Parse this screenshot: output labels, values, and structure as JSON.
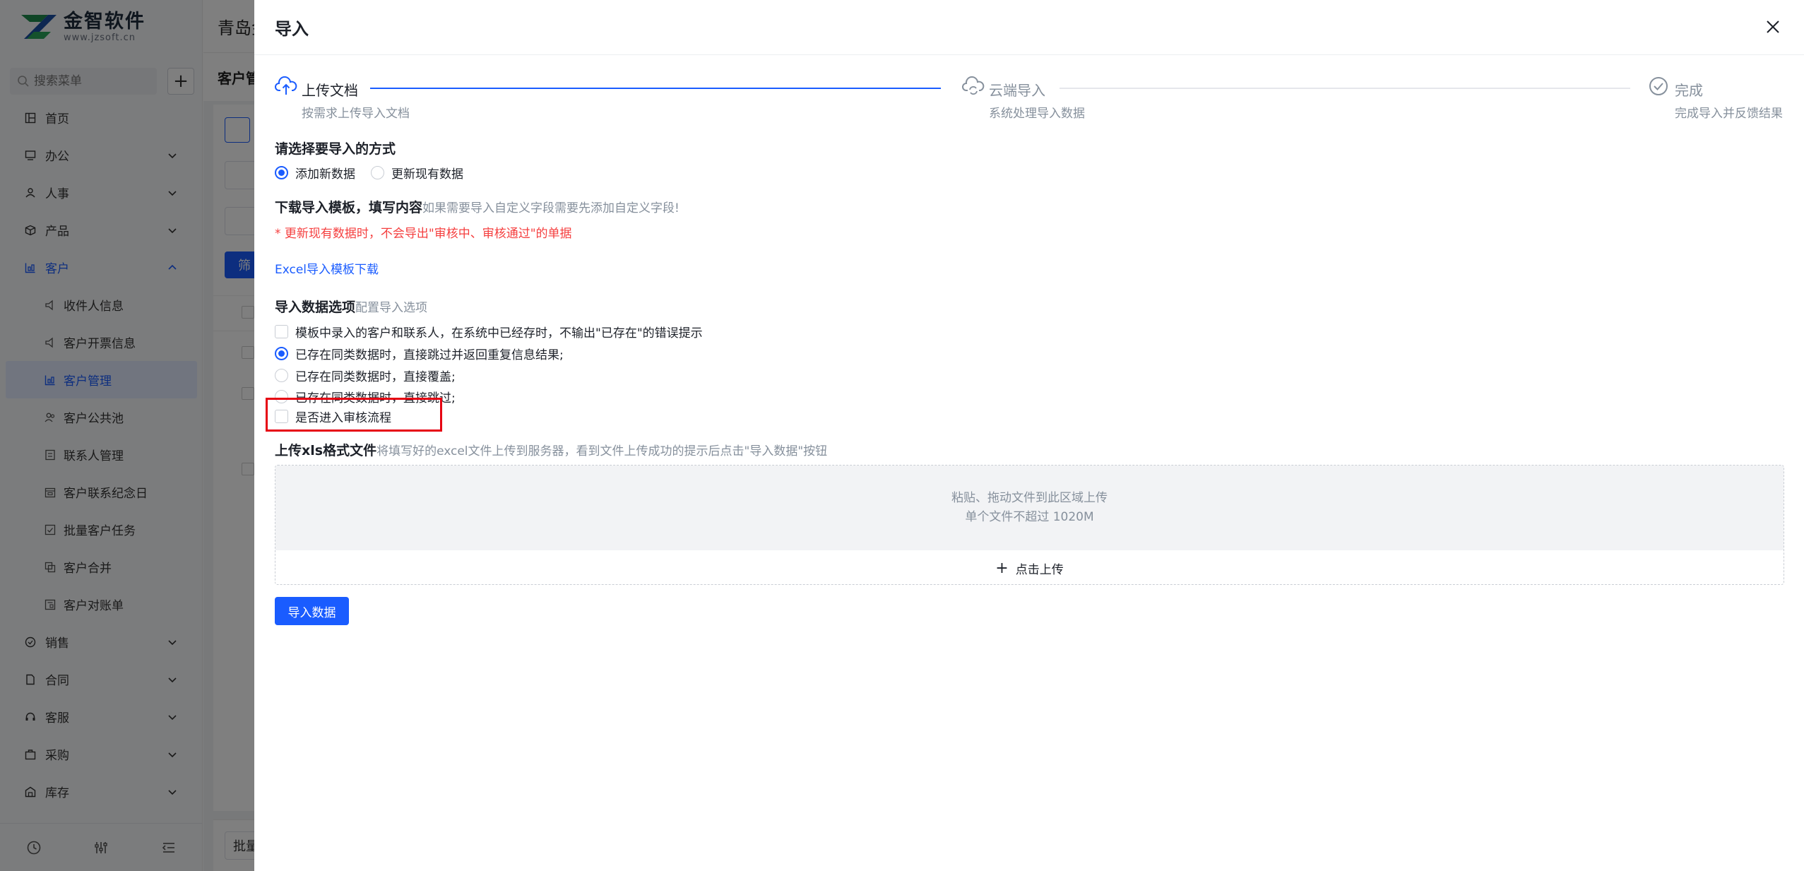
{
  "brand": {
    "name": "金智软件",
    "url": "www.jzsoft.cn"
  },
  "sidebar": {
    "search_placeholder": "搜索菜单",
    "add_label": "+",
    "items": [
      {
        "label": "首页"
      },
      {
        "label": "办公"
      },
      {
        "label": "人事"
      },
      {
        "label": "产品"
      },
      {
        "label": "客户"
      },
      {
        "label": "销售"
      },
      {
        "label": "合同"
      },
      {
        "label": "客服"
      },
      {
        "label": "采购"
      },
      {
        "label": "库存"
      }
    ],
    "sub_items": [
      {
        "label": "收件人信息"
      },
      {
        "label": "客户开票信息"
      },
      {
        "label": "客户管理"
      },
      {
        "label": "客户公共池"
      },
      {
        "label": "联系人管理"
      },
      {
        "label": "客户联系纪念日"
      },
      {
        "label": "批量客户任务"
      },
      {
        "label": "客户合并"
      },
      {
        "label": "客户对账单"
      }
    ]
  },
  "main": {
    "header_title": "青岛金",
    "tab_title": "客户管",
    "filter_label": "筛",
    "bottom_button": "批量"
  },
  "drawer": {
    "title": "导入",
    "steps": [
      {
        "title": "上传文档",
        "desc": "按需求上传导入文档"
      },
      {
        "title": "云端导入",
        "desc": "系统处理导入数据"
      },
      {
        "title": "完成",
        "desc": "完成导入并反馈结果"
      }
    ],
    "method": {
      "title": "请选择要导入的方式",
      "options": [
        "添加新数据",
        "更新现有数据"
      ]
    },
    "template": {
      "title": "下载导入模板，填写内容",
      "hint": "如果需要导入自定义字段需要先添加自定义字段!",
      "warning": "* 更新现有数据时，不会导出\"审核中、审核通过\"的单据",
      "link": "Excel导入模板下载"
    },
    "options": {
      "title": "导入数据选项",
      "hint": "配置导入选项",
      "checkbox1": "模板中录入的客户和联系人，在系统中已经存时，不输出\"已存在\"的错误提示",
      "radio1": "已存在同类数据时，直接跳过并返回重复信息结果;",
      "radio2": "已存在同类数据时，直接覆盖;",
      "radio3": "已存在同类数据时，直接跳过;",
      "checkbox2": "是否进入审核流程"
    },
    "upload": {
      "title": "上传xls格式文件",
      "hint": "将填写好的excel文件上传到服务器，看到文件上传成功的提示后点击\"导入数据\"按钮",
      "drop_line1": "粘贴、拖动文件到此区域上传",
      "drop_line2": "单个文件不超过 1020M",
      "button": "点击上传"
    },
    "submit": "导入数据"
  },
  "colors": {
    "primary": "#1a5cff",
    "danger": "#f53f3f",
    "highlight": "#e60012"
  }
}
